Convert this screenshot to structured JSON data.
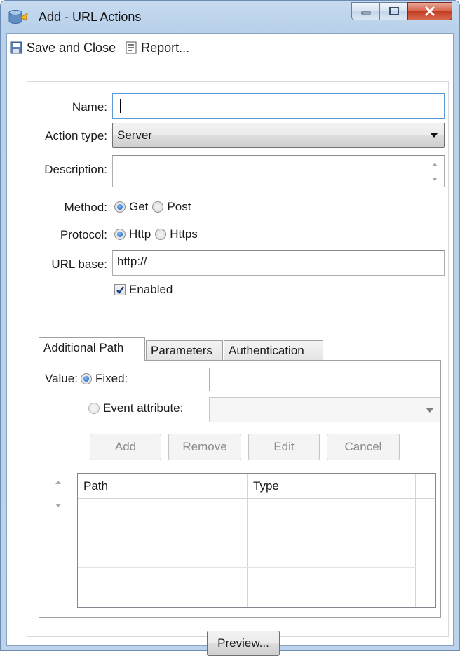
{
  "window": {
    "title": "Add - URL Actions",
    "accent_color": "#b9d1ea",
    "close_color": "#c23c22"
  },
  "toolbar": {
    "save_label": "Save and Close",
    "report_label": "Report..."
  },
  "form": {
    "name_label": "Name:",
    "name_value": "",
    "action_type_label": "Action type:",
    "action_type_value": "Server",
    "description_label": "Description:",
    "description_value": "",
    "method_label": "Method:",
    "method_options": [
      "Get",
      "Post"
    ],
    "method_selected": "Get",
    "protocol_label": "Protocol:",
    "protocol_options": [
      "Http",
      "Https"
    ],
    "protocol_selected": "Http",
    "url_base_label": "URL base:",
    "url_base_value": "http://",
    "enabled_label": "Enabled",
    "enabled_checked": true
  },
  "tabs": [
    {
      "label": "Additional Path",
      "active": true
    },
    {
      "label": "Parameters",
      "active": false
    },
    {
      "label": "Authentication",
      "active": false
    }
  ],
  "additional_path": {
    "value_label": "Value:",
    "fixed_label": "Fixed:",
    "fixed_value": "",
    "event_attribute_label": "Event attribute:",
    "event_attribute_value": "",
    "buttons": {
      "add": "Add",
      "remove": "Remove",
      "edit": "Edit",
      "cancel": "Cancel"
    },
    "table": {
      "columns": [
        "Path",
        "Type"
      ],
      "rows": []
    }
  },
  "footer": {
    "preview_label": "Preview..."
  }
}
